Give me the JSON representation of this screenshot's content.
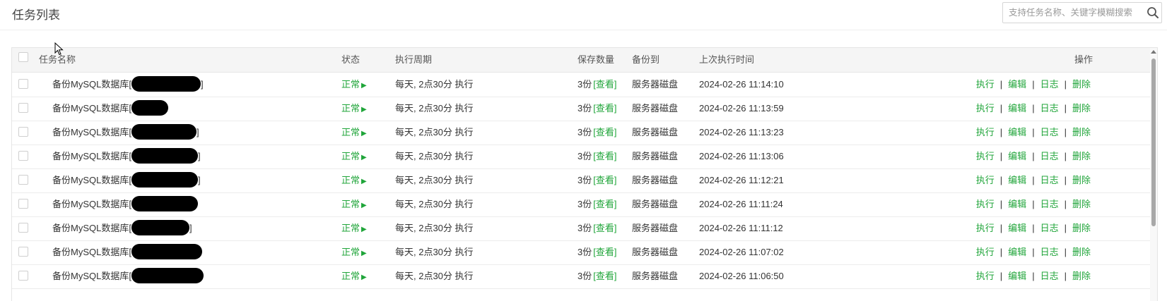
{
  "header": {
    "title": "任务列表",
    "search_placeholder": "支持任务名称、关键字模糊搜索"
  },
  "table": {
    "columns": {
      "name": "任务名称",
      "status": "状态",
      "cycle": "执行周期",
      "count": "保存数量",
      "dest": "备份到",
      "last_time": "上次执行时间",
      "ops": "操作"
    },
    "view_label": "[查看]",
    "ops_labels": {
      "run": "执行",
      "edit": "编辑",
      "log": "日志",
      "delete": "删除"
    },
    "sep": "|",
    "rows": [
      {
        "name": "备份MySQL数据库[",
        "close": "]",
        "status": "正常",
        "cycle": "每天, 2点30分 执行",
        "count": "3份",
        "dest": "服务器磁盘",
        "time": "2024-02-26 11:14:10"
      },
      {
        "name": "备份MySQL数据库[",
        "close": "",
        "status": "正常",
        "cycle": "每天, 2点30分 执行",
        "count": "3份",
        "dest": "服务器磁盘",
        "time": "2024-02-26 11:13:59"
      },
      {
        "name": "备份MySQL数据库[",
        "close": "]",
        "status": "正常",
        "cycle": "每天, 2点30分 执行",
        "count": "3份",
        "dest": "服务器磁盘",
        "time": "2024-02-26 11:13:23"
      },
      {
        "name": "备份MySQL数据库[",
        "close": "]",
        "status": "正常",
        "cycle": "每天, 2点30分 执行",
        "count": "3份",
        "dest": "服务器磁盘",
        "time": "2024-02-26 11:13:06"
      },
      {
        "name": "备份MySQL数据库[",
        "close": "]",
        "status": "正常",
        "cycle": "每天, 2点30分 执行",
        "count": "3份",
        "dest": "服务器磁盘",
        "time": "2024-02-26 11:12:21"
      },
      {
        "name": "备份MySQL数据库[",
        "close": "",
        "status": "正常",
        "cycle": "每天, 2点30分 执行",
        "count": "3份",
        "dest": "服务器磁盘",
        "time": "2024-02-26 11:11:24"
      },
      {
        "name": "备份MySQL数据库[",
        "close": "]",
        "status": "正常",
        "cycle": "每天, 2点30分 执行",
        "count": "3份",
        "dest": "服务器磁盘",
        "time": "2024-02-26 11:11:12"
      },
      {
        "name": "备份MySQL数据库[",
        "close": "",
        "status": "正常",
        "cycle": "每天, 2点30分 执行",
        "count": "3份",
        "dest": "服务器磁盘",
        "time": "2024-02-26 11:07:02"
      },
      {
        "name": "备份MySQL数据库[",
        "close": "",
        "status": "正常",
        "cycle": "每天, 2点30分 执行",
        "count": "3份",
        "dest": "服务器磁盘",
        "time": "2024-02-26 11:06:50"
      }
    ]
  },
  "colors": {
    "accent": "#20a53a",
    "header_bg": "#f5f5f5",
    "redaction": "#000000"
  }
}
